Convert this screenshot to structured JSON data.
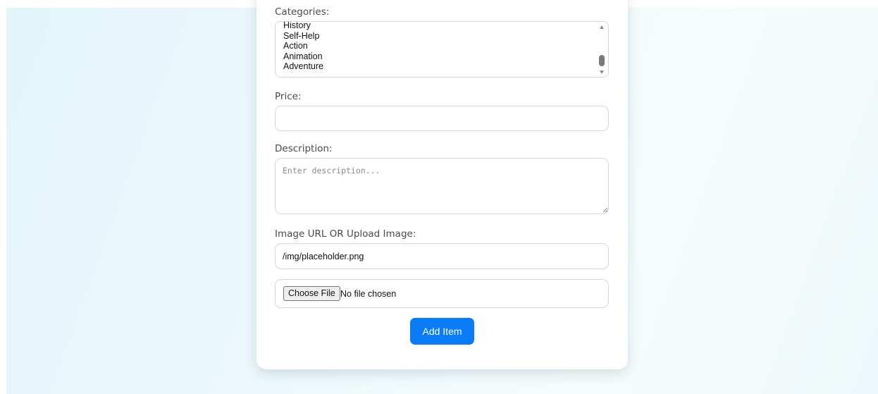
{
  "form": {
    "categories_label": "Categories:",
    "categories_options": [
      "History",
      "Self-Help",
      "Action",
      "Animation",
      "Adventure"
    ],
    "price_label": "Price:",
    "price_value": "",
    "description_label": "Description:",
    "description_placeholder": "Enter description...",
    "image_label": "Image URL OR Upload Image:",
    "image_url_value": "/img/placeholder.png",
    "file_button_label": "Choose File",
    "file_status": "No file chosen",
    "submit_label": "Add Item"
  },
  "colors": {
    "accent": "#0a7cf7",
    "background": "#e3f5fa"
  }
}
